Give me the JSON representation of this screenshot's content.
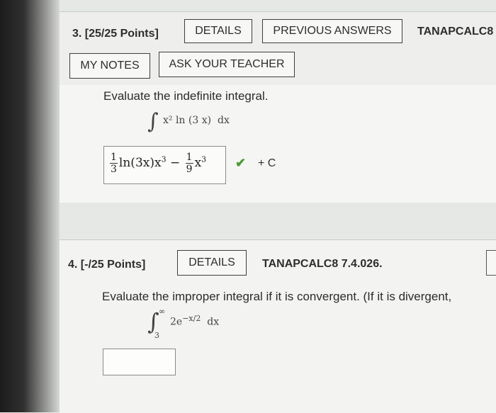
{
  "q3": {
    "label": "3. [25/25 Points]",
    "details_label": "DETAILS",
    "previous_answers_label": "PREVIOUS ANSWERS",
    "code": "TANAPCALC8",
    "my_notes_label": "MY NOTES",
    "ask_teacher_label": "ASK YOUR TEACHER",
    "prompt": "Evaluate the indefinite integral.",
    "integral": {
      "sign": "∫",
      "integrand": "x² ln (3 x)  dx"
    },
    "answer": {
      "coef1_num": "1",
      "coef1_den": "3",
      "term1": "ln(3x)x",
      "term1_exp": "3",
      "minus": "−",
      "coef2_num": "1",
      "coef2_den": "9",
      "term2": "x",
      "term2_exp": "3"
    },
    "check": "✔",
    "plus_c": "+ C"
  },
  "q4": {
    "label": "4. [-/25 Points]",
    "details_label": "DETAILS",
    "code": "TANAPCALC8 7.4.026.",
    "prompt": "Evaluate the improper integral if it is convergent. (If it is divergent,",
    "integral": {
      "sign": "∫",
      "upper": "∞",
      "lower": "3",
      "integrand": "2e",
      "exponent": "−x/2",
      "dx": "dx"
    }
  },
  "colors": {
    "check_green": "#4c9a35",
    "border_dark": "#3d3d3d"
  }
}
